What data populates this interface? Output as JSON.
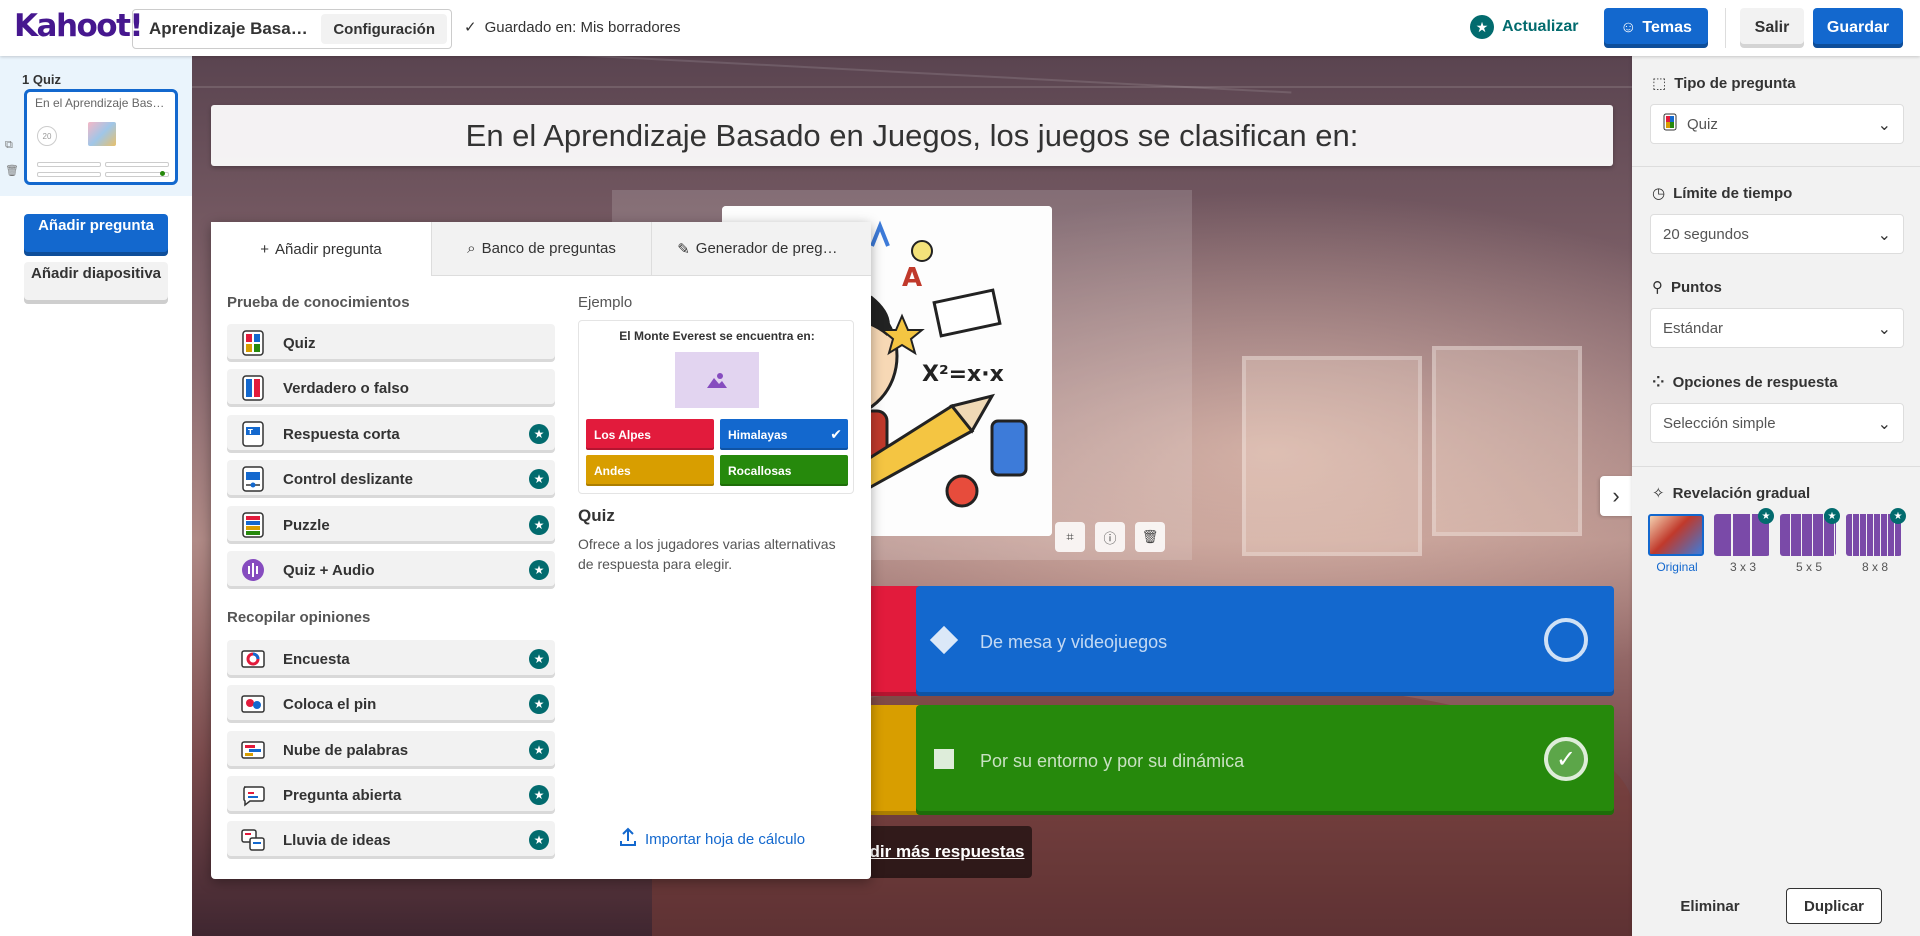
{
  "topbar": {
    "logo": "Kahoot!",
    "title": "Aprendizaje Basado en Juegos",
    "config_label": "Configuración",
    "saved_text": "Guardado en: Mis borradores",
    "upgrade_label": "Actualizar",
    "themes_label": "Temas",
    "exit_label": "Salir",
    "save_label": "Guardar"
  },
  "sidebar": {
    "slide_label": "1  Quiz",
    "thumb_title": "En el Aprendizaje Basado en Juegos, los juegos se clasifican en:",
    "thumb_timer": "20",
    "add_question": "Añadir pregunta",
    "add_slide": "Añadir diapositiva"
  },
  "canvas": {
    "question": "En el Aprendizaje Basado en Juegos, los juegos se clasifican en:",
    "answers": [
      {
        "text": "De mesa y videojuegos",
        "color": "#1368ce",
        "shape": "diamond"
      },
      {
        "text": "Por su entorno y por su dinámica",
        "color": "#26890c",
        "shape": "square",
        "correct": true
      }
    ],
    "more_answers": "dir más respuestas"
  },
  "panel": {
    "tabs": [
      "Añadir pregunta",
      "Banco de preguntas",
      "Generador de preguntas"
    ],
    "section_knowledge": "Prueba de conocimientos",
    "knowledge_types": [
      {
        "label": "Quiz",
        "premium": false,
        "icon": "quiz-icon"
      },
      {
        "label": "Verdadero o falso",
        "premium": false,
        "icon": "true-false-icon"
      },
      {
        "label": "Respuesta corta",
        "premium": true,
        "icon": "short-answer-icon"
      },
      {
        "label": "Control deslizante",
        "premium": true,
        "icon": "slider-icon"
      },
      {
        "label": "Puzzle",
        "premium": true,
        "icon": "puzzle-icon"
      },
      {
        "label": "Quiz + Audio",
        "premium": true,
        "icon": "audio-icon"
      }
    ],
    "section_opinions": "Recopilar opiniones",
    "opinion_types": [
      {
        "label": "Encuesta",
        "premium": true,
        "icon": "poll-icon"
      },
      {
        "label": "Coloca el pin",
        "premium": true,
        "icon": "pin-icon"
      },
      {
        "label": "Nube de palabras",
        "premium": true,
        "icon": "word-cloud-icon"
      },
      {
        "label": "Pregunta abierta",
        "premium": true,
        "icon": "open-ended-icon"
      },
      {
        "label": "Lluvia de ideas",
        "premium": true,
        "icon": "brainstorm-icon"
      }
    ],
    "example_label": "Ejemplo",
    "example": {
      "title": "El Monte Everest se encuentra en:",
      "answers": [
        {
          "text": "Los Alpes",
          "color": "#e21b3c"
        },
        {
          "text": "Himalayas",
          "color": "#1368ce",
          "correct": true
        },
        {
          "text": "Andes",
          "color": "#d89e00"
        },
        {
          "text": "Rocallosas",
          "color": "#26890c"
        }
      ]
    },
    "example_name": "Quiz",
    "example_desc": "Ofrece a los jugadores varias alternativas de respuesta para elegir.",
    "import_label": "Importar hoja de cálculo"
  },
  "rightbar": {
    "question_type_label": "Tipo de pregunta",
    "question_type_value": "Quiz",
    "time_limit_label": "Límite de tiempo",
    "time_limit_value": "20 segundos",
    "points_label": "Puntos",
    "points_value": "Estándar",
    "answer_options_label": "Opciones de respuesta",
    "answer_options_value": "Selección simple",
    "reveal_label": "Revelación gradual",
    "reveal_options": [
      "Original",
      "3 x 3",
      "5 x 5",
      "8 x 8"
    ],
    "delete_label": "Eliminar",
    "duplicate_label": "Duplicar"
  }
}
